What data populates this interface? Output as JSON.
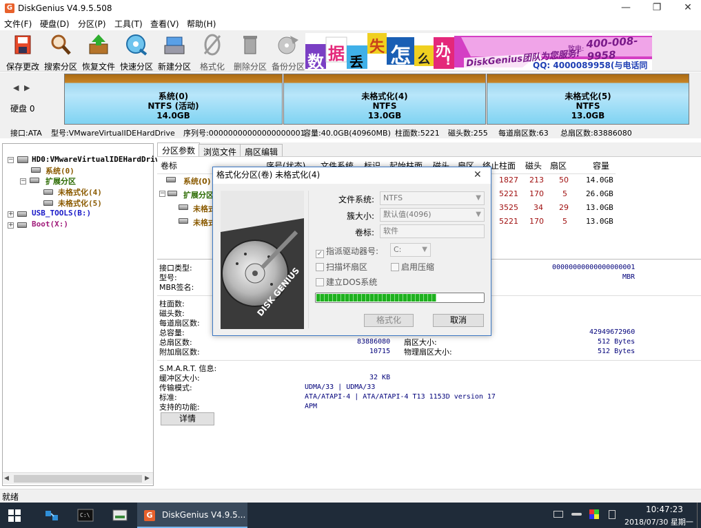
{
  "window": {
    "title": "DiskGenius V4.9.5.508",
    "min_label": "—",
    "max_label": "❐",
    "close_label": "✕"
  },
  "menu": [
    "文件(F)",
    "硬盘(D)",
    "分区(P)",
    "工具(T)",
    "查看(V)",
    "帮助(H)"
  ],
  "toolbar": [
    {
      "label": "保存更改",
      "icon": "save-changes-icon",
      "enabled": true
    },
    {
      "label": "搜索分区",
      "icon": "search-partition-icon",
      "enabled": true
    },
    {
      "label": "恢复文件",
      "icon": "recover-files-icon",
      "enabled": true
    },
    {
      "label": "快速分区",
      "icon": "quick-partition-icon",
      "enabled": true
    },
    {
      "label": "新建分区",
      "icon": "new-partition-icon",
      "enabled": true
    },
    {
      "label": "格式化",
      "icon": "format-icon",
      "enabled": false
    },
    {
      "label": "删除分区",
      "icon": "delete-partition-icon",
      "enabled": false
    },
    {
      "label": "备份分区",
      "icon": "backup-partition-icon",
      "enabled": false
    }
  ],
  "banner": {
    "chars": [
      "数",
      "据",
      "丢",
      "失",
      "怎",
      "么",
      "办",
      "!"
    ],
    "slogan": "DiskGenius团队为您服务!",
    "phone_label": "致电:",
    "phone": "400-008-9958",
    "qq": "QQ: 4000089958(与电话同号)"
  },
  "disk_map": {
    "nav_left": "◀",
    "nav_right": "▶",
    "disk_label": "硬盘 0",
    "partitions": [
      {
        "name": "系统(0)",
        "fs": "NTFS (活动)",
        "size": "14.0GB"
      },
      {
        "name": "未格式化(4)",
        "fs": "NTFS",
        "size": "13.0GB"
      },
      {
        "name": "未格式化(5)",
        "fs": "NTFS",
        "size": "13.0GB"
      }
    ]
  },
  "disk_info": {
    "interface": "接口:ATA",
    "model": "型号:VMwareVirtualIDEHardDrive",
    "serial": "序列号:00000000000000000001",
    "capacity": "容量:40.0GB(40960MB)",
    "cylinders": "柱面数:5221",
    "heads": "磁头数:255",
    "sectors_per_track": "每道扇区数:63",
    "total_sectors": "总扇区数:83886080"
  },
  "tree": {
    "disk": "HD0:VMwareVirtualIDEHardDrive",
    "system": "系统(0)",
    "extended": "扩展分区",
    "unformatted4": "未格式化(4)",
    "unformatted5": "未格式化(5)",
    "usb": "USB_TOOLS(B:)",
    "boot": "Boot(X:)"
  },
  "tabs": [
    "分区参数",
    "浏览文件",
    "扇区编辑"
  ],
  "grid": {
    "headers": [
      "卷标",
      "序号(状态)",
      "文件系统",
      "标识",
      "起始柱面",
      "磁头",
      "扇区",
      "终止柱面",
      "磁头",
      "扇区",
      "容量"
    ],
    "rows": [
      {
        "label": "系统(0)",
        "end_cyl": "1827",
        "head": "213",
        "sector": "50",
        "size": "14.0GB"
      },
      {
        "label": "扩展分区",
        "end_cyl": "5221",
        "head": "170",
        "sector": "5",
        "size": "26.0GB"
      },
      {
        "label": "未格式化(4)",
        "end_cyl": "3525",
        "head": "34",
        "sector": "29",
        "size": "13.0GB"
      },
      {
        "label": "未格式化(5)",
        "end_cyl": "5221",
        "head": "170",
        "sector": "5",
        "size": "13.0GB"
      }
    ]
  },
  "details": {
    "interface_label": "接口类型:",
    "model_label": "型号:",
    "mbr_label": "MBR签名:",
    "serial_value": "00000000000000000001",
    "mbr_value": "MBR",
    "cyl_label": "柱面数:",
    "heads_label": "磁头数:",
    "spt_label": "每道扇区数:",
    "capacity_label": "总容量:",
    "capacity_value": "42949672960",
    "total_sectors_label": "总扇区数:",
    "total_sectors_value": "83886080",
    "sector_size_label": "扇区大小:",
    "sector_size_value": "512 Bytes",
    "extra_sectors_label": "附加扇区数:",
    "extra_sectors_value": "10715",
    "phys_sector_label": "物理扇区大小:",
    "phys_sector_value": "512 Bytes",
    "smart_label": "S.M.A.R.T. 信息:",
    "buffer_label": "缓冲区大小:",
    "buffer_value": "32 KB",
    "transfer_label": "传输模式:",
    "transfer_value": "UDMA/33 | UDMA/33",
    "standard_label": "标准:",
    "standard_value": "ATA/ATAPI-4 | ATA/ATAPI-4 T13 1153D version 17",
    "features_label": "支持的功能:",
    "features_value": "APM",
    "detail_button": "详情"
  },
  "dialog": {
    "title": "格式化分区(卷) 未格式化(4)",
    "close": "✕",
    "fs_label": "文件系统:",
    "fs_value": "NTFS",
    "cluster_label": "簇大小:",
    "cluster_value": "默认值(4096)",
    "volume_label": "卷标:",
    "volume_value": "软件",
    "assign_drive_label": "指派驱动器号:",
    "assign_drive_checked": true,
    "drive_value": "C:",
    "scan_bad_label": "扫描坏扇区",
    "compress_label": "启用压缩",
    "dos_label": "建立DOS系统",
    "progress": 0.72,
    "format_button": "格式化",
    "cancel_button": "取消",
    "image_text": "DISK GENIUS"
  },
  "status": {
    "text": "就绪"
  },
  "taskbar": {
    "app_label": "DiskGenius V4.9.5...",
    "time": "10:47:23",
    "date": "2018/07/30 星期一"
  },
  "colors": {
    "accent": "#3c78c4",
    "progress": "#1fb01f",
    "partition": "#7fd3f2",
    "tree_brown": "#8a5a00",
    "value_blue": "#00007a"
  }
}
